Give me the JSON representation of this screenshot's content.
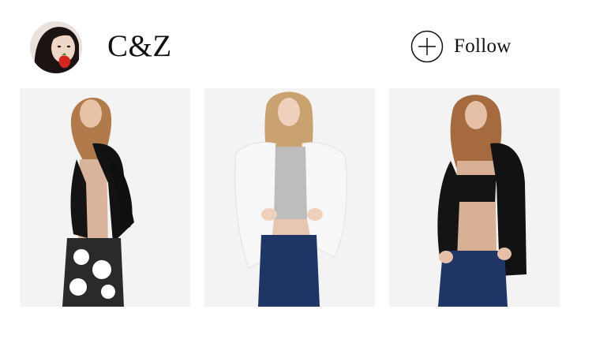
{
  "profile": {
    "username": "C&Z",
    "avatar_icon": "user-avatar"
  },
  "follow": {
    "label": "Follow",
    "icon": "plus-circle-icon"
  },
  "photos": [
    {
      "icon": "fashion-photo",
      "jacket_color": "#121212",
      "pants_color": "#2a2a2a",
      "top_color": "#d9b39a"
    },
    {
      "icon": "fashion-photo",
      "jacket_color": "#f7f7f7",
      "pants_color": "#1f3566",
      "top_color": "#bdbdbd"
    },
    {
      "icon": "fashion-photo",
      "jacket_color": "#121212",
      "pants_color": "#1f3566",
      "top_color": "#141414"
    }
  ],
  "colors": {
    "background": "#ffffff",
    "text": "#111111",
    "photo_background": "#f3f3f3"
  }
}
